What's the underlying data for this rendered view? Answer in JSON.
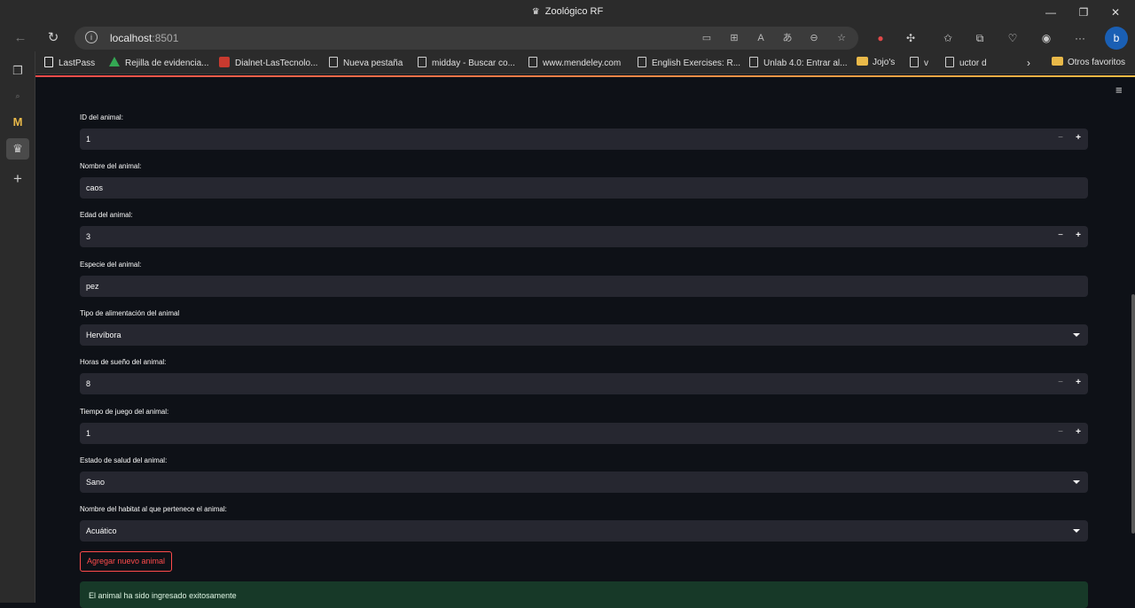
{
  "browser": {
    "window_title": "Zoológico RF",
    "url_host": "localhost",
    "url_port": ":8501",
    "window_controls": {
      "minimize": "—",
      "maximize": "❐",
      "close": "✕"
    }
  },
  "bookmarks": [
    {
      "label": "LastPass",
      "icon": "lastpass-icon"
    },
    {
      "label": "Rejilla de evidencia...",
      "icon": "drive-icon"
    },
    {
      "label": "Dialnet-LasTecnolo...",
      "icon": "pdf-icon"
    },
    {
      "label": "Nueva pestaña",
      "icon": "page-icon"
    },
    {
      "label": "midday - Buscar co...",
      "icon": "page-icon"
    },
    {
      "label": "www.mendeley.com",
      "icon": "page-icon"
    },
    {
      "label": "English Exercises: R...",
      "icon": "page-icon"
    },
    {
      "label": "Unlab 4.0: Entrar al...",
      "icon": "page-icon"
    },
    {
      "label": "Jojo's",
      "icon": "folder-icon"
    },
    {
      "label": "v",
      "icon": "page-icon"
    },
    {
      "label": "uctor d",
      "icon": "page-icon"
    },
    {
      "label": "Otros favoritos",
      "icon": "folder-icon"
    }
  ],
  "form": {
    "id": {
      "label": "ID del animal:",
      "value": "1"
    },
    "name": {
      "label": "Nombre del animal:",
      "value": "caos"
    },
    "age": {
      "label": "Edad del animal:",
      "value": "3"
    },
    "species": {
      "label": "Especie del animal:",
      "value": "pez"
    },
    "diet": {
      "label": "Tipo de alimentación del animal",
      "value": "Hervíbora"
    },
    "sleep": {
      "label": "Horas de sueño del animal:",
      "value": "8"
    },
    "play": {
      "label": "Tiempo de juego del animal:",
      "value": "1"
    },
    "health": {
      "label": "Estado de salud del animal:",
      "value": "Sano"
    },
    "habitat": {
      "label": "Nombre del habitat al que pertenece el animal:",
      "value": "Acuático"
    },
    "stepper": {
      "minus": "−",
      "plus": "+"
    }
  },
  "actions": {
    "add_label": "Agregar nuevo animal"
  },
  "alert": {
    "success_message": "El animal ha sido ingresado exitosamente"
  },
  "colors": {
    "accent": "#ff4b4b",
    "background": "#0e1117",
    "input_bg": "#262730",
    "success_bg": "#173928"
  }
}
